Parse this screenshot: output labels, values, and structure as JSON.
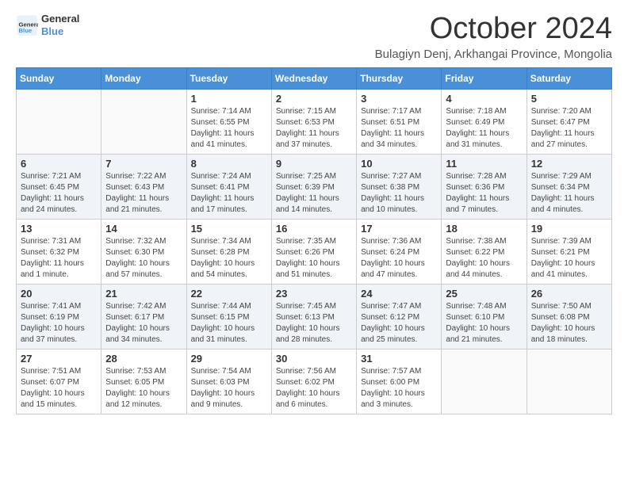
{
  "logo": {
    "text_general": "General",
    "text_blue": "Blue"
  },
  "header": {
    "month": "October 2024",
    "location": "Bulagiyn Denj, Arkhangai Province, Mongolia"
  },
  "weekdays": [
    "Sunday",
    "Monday",
    "Tuesday",
    "Wednesday",
    "Thursday",
    "Friday",
    "Saturday"
  ],
  "weeks": [
    [
      {
        "day": "",
        "info": ""
      },
      {
        "day": "",
        "info": ""
      },
      {
        "day": "1",
        "info": "Sunrise: 7:14 AM\nSunset: 6:55 PM\nDaylight: 11 hours and 41 minutes."
      },
      {
        "day": "2",
        "info": "Sunrise: 7:15 AM\nSunset: 6:53 PM\nDaylight: 11 hours and 37 minutes."
      },
      {
        "day": "3",
        "info": "Sunrise: 7:17 AM\nSunset: 6:51 PM\nDaylight: 11 hours and 34 minutes."
      },
      {
        "day": "4",
        "info": "Sunrise: 7:18 AM\nSunset: 6:49 PM\nDaylight: 11 hours and 31 minutes."
      },
      {
        "day": "5",
        "info": "Sunrise: 7:20 AM\nSunset: 6:47 PM\nDaylight: 11 hours and 27 minutes."
      }
    ],
    [
      {
        "day": "6",
        "info": "Sunrise: 7:21 AM\nSunset: 6:45 PM\nDaylight: 11 hours and 24 minutes."
      },
      {
        "day": "7",
        "info": "Sunrise: 7:22 AM\nSunset: 6:43 PM\nDaylight: 11 hours and 21 minutes."
      },
      {
        "day": "8",
        "info": "Sunrise: 7:24 AM\nSunset: 6:41 PM\nDaylight: 11 hours and 17 minutes."
      },
      {
        "day": "9",
        "info": "Sunrise: 7:25 AM\nSunset: 6:39 PM\nDaylight: 11 hours and 14 minutes."
      },
      {
        "day": "10",
        "info": "Sunrise: 7:27 AM\nSunset: 6:38 PM\nDaylight: 11 hours and 10 minutes."
      },
      {
        "day": "11",
        "info": "Sunrise: 7:28 AM\nSunset: 6:36 PM\nDaylight: 11 hours and 7 minutes."
      },
      {
        "day": "12",
        "info": "Sunrise: 7:29 AM\nSunset: 6:34 PM\nDaylight: 11 hours and 4 minutes."
      }
    ],
    [
      {
        "day": "13",
        "info": "Sunrise: 7:31 AM\nSunset: 6:32 PM\nDaylight: 11 hours and 1 minute."
      },
      {
        "day": "14",
        "info": "Sunrise: 7:32 AM\nSunset: 6:30 PM\nDaylight: 10 hours and 57 minutes."
      },
      {
        "day": "15",
        "info": "Sunrise: 7:34 AM\nSunset: 6:28 PM\nDaylight: 10 hours and 54 minutes."
      },
      {
        "day": "16",
        "info": "Sunrise: 7:35 AM\nSunset: 6:26 PM\nDaylight: 10 hours and 51 minutes."
      },
      {
        "day": "17",
        "info": "Sunrise: 7:36 AM\nSunset: 6:24 PM\nDaylight: 10 hours and 47 minutes."
      },
      {
        "day": "18",
        "info": "Sunrise: 7:38 AM\nSunset: 6:22 PM\nDaylight: 10 hours and 44 minutes."
      },
      {
        "day": "19",
        "info": "Sunrise: 7:39 AM\nSunset: 6:21 PM\nDaylight: 10 hours and 41 minutes."
      }
    ],
    [
      {
        "day": "20",
        "info": "Sunrise: 7:41 AM\nSunset: 6:19 PM\nDaylight: 10 hours and 37 minutes."
      },
      {
        "day": "21",
        "info": "Sunrise: 7:42 AM\nSunset: 6:17 PM\nDaylight: 10 hours and 34 minutes."
      },
      {
        "day": "22",
        "info": "Sunrise: 7:44 AM\nSunset: 6:15 PM\nDaylight: 10 hours and 31 minutes."
      },
      {
        "day": "23",
        "info": "Sunrise: 7:45 AM\nSunset: 6:13 PM\nDaylight: 10 hours and 28 minutes."
      },
      {
        "day": "24",
        "info": "Sunrise: 7:47 AM\nSunset: 6:12 PM\nDaylight: 10 hours and 25 minutes."
      },
      {
        "day": "25",
        "info": "Sunrise: 7:48 AM\nSunset: 6:10 PM\nDaylight: 10 hours and 21 minutes."
      },
      {
        "day": "26",
        "info": "Sunrise: 7:50 AM\nSunset: 6:08 PM\nDaylight: 10 hours and 18 minutes."
      }
    ],
    [
      {
        "day": "27",
        "info": "Sunrise: 7:51 AM\nSunset: 6:07 PM\nDaylight: 10 hours and 15 minutes."
      },
      {
        "day": "28",
        "info": "Sunrise: 7:53 AM\nSunset: 6:05 PM\nDaylight: 10 hours and 12 minutes."
      },
      {
        "day": "29",
        "info": "Sunrise: 7:54 AM\nSunset: 6:03 PM\nDaylight: 10 hours and 9 minutes."
      },
      {
        "day": "30",
        "info": "Sunrise: 7:56 AM\nSunset: 6:02 PM\nDaylight: 10 hours and 6 minutes."
      },
      {
        "day": "31",
        "info": "Sunrise: 7:57 AM\nSunset: 6:00 PM\nDaylight: 10 hours and 3 minutes."
      },
      {
        "day": "",
        "info": ""
      },
      {
        "day": "",
        "info": ""
      }
    ]
  ]
}
